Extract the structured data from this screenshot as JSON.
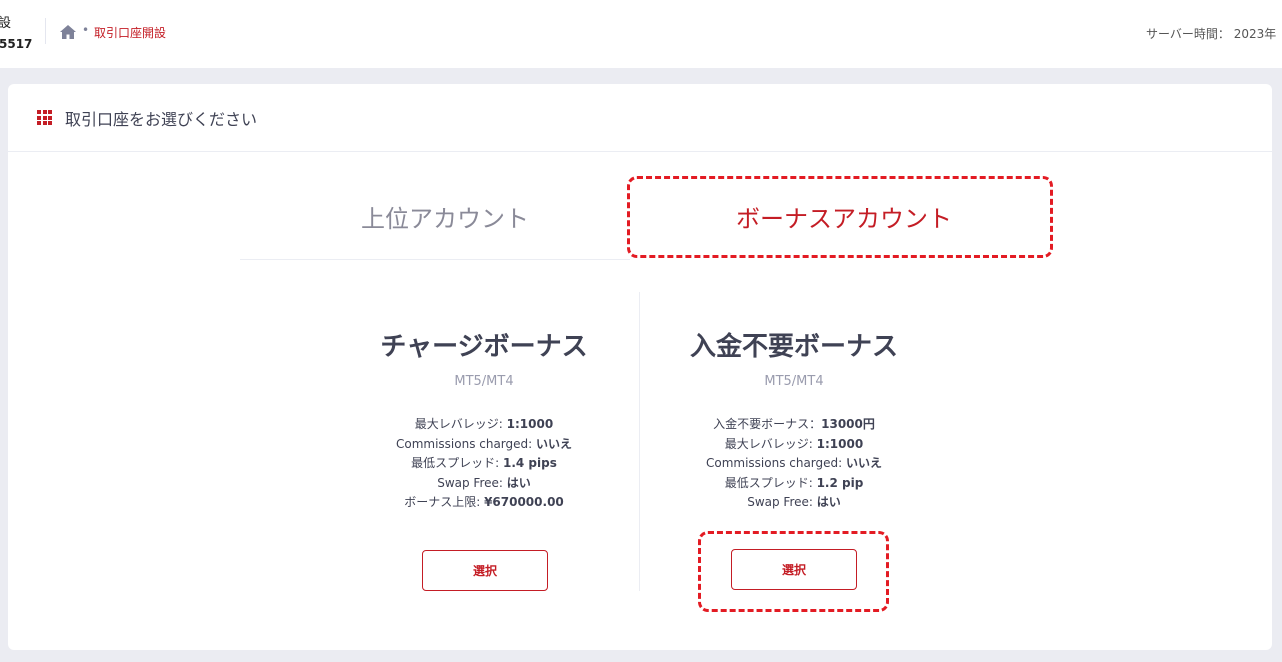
{
  "header": {
    "account_title": "設",
    "account_number": "5517",
    "breadcrumb": {
      "home_icon": "home-icon",
      "separator": "•",
      "current": "取引口座開設"
    },
    "server_time": "サーバー時間： 2023年"
  },
  "card": {
    "icon": "grid-icon",
    "title": "取引口座をお選びください",
    "tabs": [
      {
        "label": "上位アカウント",
        "active": false
      },
      {
        "label": "ボーナスアカウント",
        "active": true
      }
    ],
    "plans": [
      {
        "name": "チャージボーナス",
        "platform": "MT5/MT4",
        "specs": [
          {
            "label": "最大レバレッジ: ",
            "value": "1:1000"
          },
          {
            "label": "Commissions charged: ",
            "value": "いいえ"
          },
          {
            "label": "最低スプレッド: ",
            "value": "1.4 pips"
          },
          {
            "label": "Swap Free: ",
            "value": "はい"
          },
          {
            "label": "ボーナス上限: ",
            "value": "¥670000.00"
          }
        ],
        "button": "選択"
      },
      {
        "name": "入金不要ボーナス",
        "platform": "MT5/MT4",
        "specs": [
          {
            "label": "入金不要ボーナス：",
            "value": "13000円"
          },
          {
            "label": "最大レバレッジ: ",
            "value": "1:1000"
          },
          {
            "label": "Commissions charged: ",
            "value": "いいえ"
          },
          {
            "label": "最低スプレッド: ",
            "value": "1.2 pip"
          },
          {
            "label": "Swap Free: ",
            "value": "はい"
          }
        ],
        "button": "選択"
      }
    ]
  },
  "colors": {
    "accent": "#c41d25",
    "highlight": "#e31b23",
    "text": "#3f4254",
    "muted": "#9a9cae",
    "background": "#ebecf2"
  }
}
